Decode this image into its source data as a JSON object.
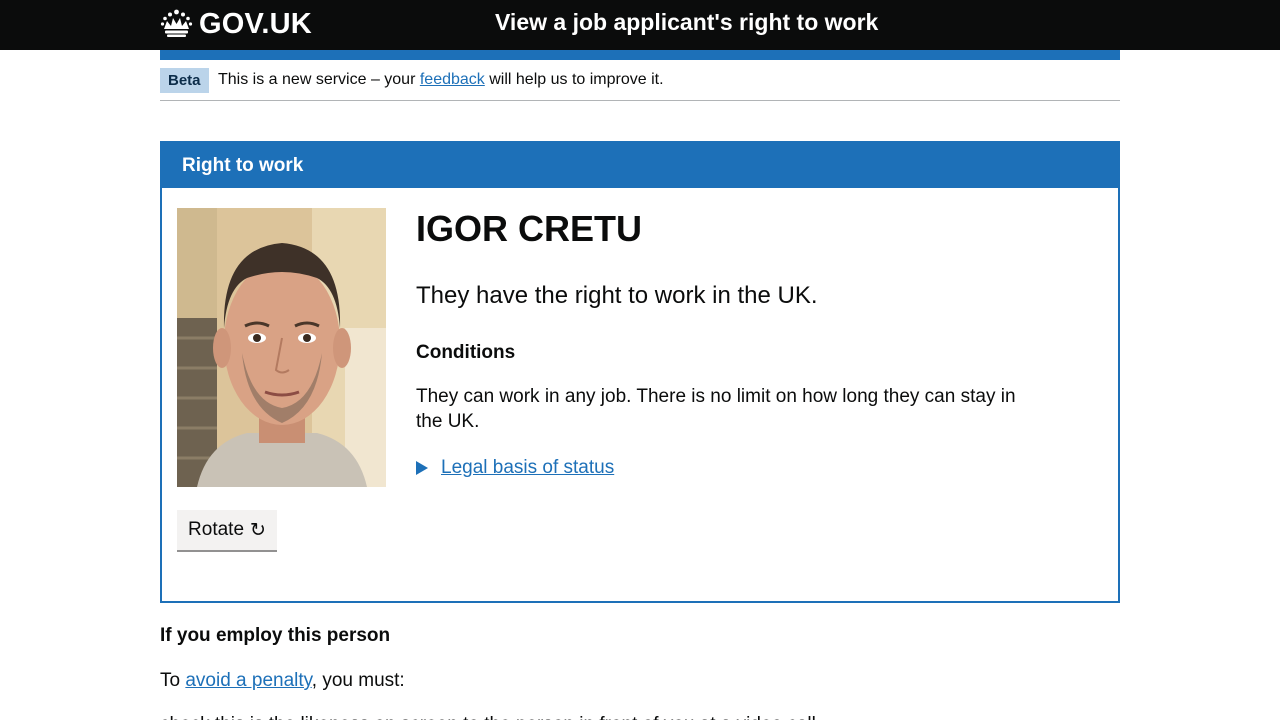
{
  "header": {
    "logo_text": "GOV.UK",
    "service_name": "View a job applicant's right to work",
    "background": "#0b0c0c",
    "accent": "#1d70b8"
  },
  "phase_banner": {
    "tag": "Beta",
    "text_before": "This is a new service – your ",
    "link": "feedback",
    "text_after": " will help us to improve it."
  },
  "panel": {
    "title": "Right to work",
    "name": "IGOR CRETU",
    "status": "They have the right to work in the UK.",
    "conditions_heading": "Conditions",
    "conditions_text": "They can work in any job. There is no limit on how long they can stay in the UK.",
    "details_summary": "Legal basis of status",
    "rotate_label": "Rotate",
    "rotate_icon": "↻"
  },
  "employ": {
    "heading": "If you employ this person",
    "penalty_before": "To ",
    "penalty_link": "avoid a penalty",
    "penalty_after": ", you must:",
    "cut_line": "check this is the likeness on screen to the person in front of you at a video call"
  },
  "icons": {
    "crown": "crown-icon",
    "details_arrow": "triangle-right-icon",
    "rotate": "rotate-icon"
  }
}
